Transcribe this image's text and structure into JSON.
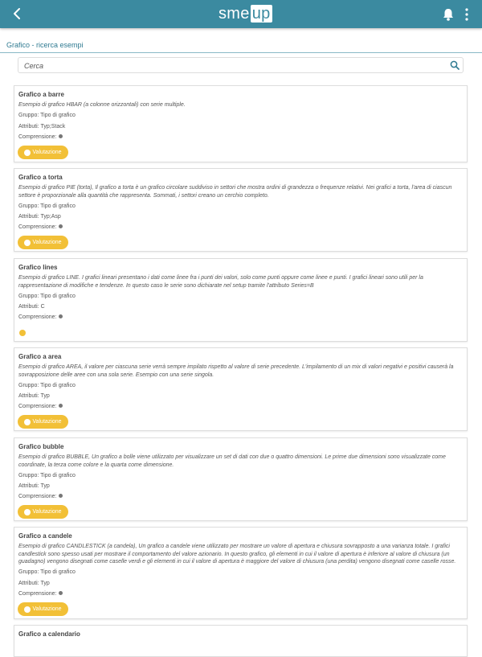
{
  "header": {
    "logo_left": "sme",
    "logo_right": "up",
    "back_icon": "arrow-left-icon",
    "bell_icon": "bell-icon",
    "menu_icon": "more-vertical-icon"
  },
  "breadcrumb": "Grafico - ricerca esempi",
  "search": {
    "placeholder": "Cerca",
    "value": ""
  },
  "labels": {
    "group": "Gruppo:",
    "attributes": "Attributi:",
    "comprehension": "Comprensione:"
  },
  "colors": {
    "header": "#3b8aa0",
    "button": "#f2c037"
  },
  "cards": [
    {
      "title": "Grafico a barre",
      "desc": "Esempio di grafico HBAR (a colonne orizzontali) con serie multiple.",
      "group": "Tipo di grafico",
      "attributes": "Typ;Stack",
      "button": "Valutazione"
    },
    {
      "title": "Grafico a torta",
      "desc": "Esempio di grafico PIE (torta), Il grafico a torta è un grafico circolare suddiviso in settori che mostra ordini di grandezza o frequenze relativi. Nei grafici a torta, l'area di ciascun settore è proporzionale alla quantità che rappresenta. Sommati, i settori creano un cerchio completo.",
      "group": "Tipo di grafico",
      "attributes": "Typ;Asp",
      "button": "Valutazione"
    },
    {
      "title": "Grafico lines",
      "desc": "Esempio di grafico LINE. I grafici lineari presentano i dati come linee fra i punti dei valori, solo come punti oppure come linee e punti. I grafici lineari sono utili per la rappresentazione di modifiche e tendenze. In questo caso le serie sono dichiarate nel setup tramite l'attributo Series=B",
      "group": "Tipo di grafico",
      "attributes": "C",
      "button": ""
    },
    {
      "title": "Grafico a area",
      "desc": "Esempio di grafico AREA, il valore per ciascuna serie verrà sempre impilato rispetto al valore di serie precedente. L'impilamento di un mix di valori negativi e positivi causerà la sovrapposizione delle aree con una sola serie. Esempio con una serie singola.",
      "group": "Tipo di grafico",
      "attributes": "Typ",
      "button": "Valutazione"
    },
    {
      "title": "Grafico bubble",
      "desc": "Esempio di grafico BUBBLE, Un grafico a bolle viene utilizzato per visualizzare un set di dati con due o quattro dimensioni. Le prime due dimensioni sono visualizzate come coordinate, la terza come colore e la quarta come dimensione.",
      "group": "Tipo di grafico",
      "attributes": "Typ",
      "button": "Valutazione"
    },
    {
      "title": "Grafico a candele",
      "desc": "Esempio di grafico CANDLESTICK (a candela), Un grafico a candele viene utilizzato per mostrare un valore di apertura e chiusura sovrapposto a una varianza totale. I grafici candlestick sono spesso usati per mostrare il comportamento del valore azionario. In questo grafico, gli elementi in cui il valore di apertura è inferiore al valore di chiusura (un guadagno) vengono disegnati come caselle verdi e gli elementi in cui il valore di apertura è maggiore del valore di chiusura (una perdita) vengono disegnati come caselle rosse.",
      "group": "Tipo di grafico",
      "attributes": "Typ",
      "button": "Valutazione"
    },
    {
      "title": "Grafico a calendario",
      "desc": "",
      "group": "",
      "attributes": "",
      "button": ""
    }
  ]
}
